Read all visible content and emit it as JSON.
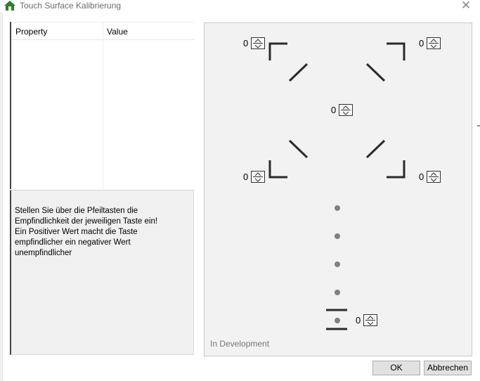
{
  "window": {
    "title": "Touch Surface Kalibrierung",
    "close_glyph": "✕"
  },
  "property_grid": {
    "columns": [
      "Property",
      "Value"
    ]
  },
  "help": {
    "text": "Stellen Sie über die Pfeiltasten die\nEmpfindlichkeit der jeweiligen Taste ein!\nEin Positiver Wert macht die Taste\nempfindlicher ein negativer Wert\nunempfindlicher"
  },
  "calibration": {
    "status_label": "In Development",
    "spinners": {
      "top_left": "0",
      "top_right": "0",
      "center": "0",
      "bottom_left": "0",
      "bottom_right": "0",
      "bottom": "0"
    }
  },
  "buttons": {
    "ok": "OK",
    "cancel": "Abbrechen"
  }
}
